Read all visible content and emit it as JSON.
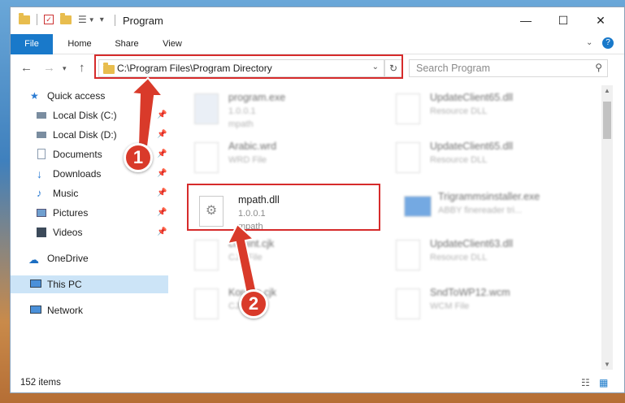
{
  "window": {
    "title": "Program"
  },
  "ribbon": {
    "tabs": [
      "File",
      "Home",
      "Share",
      "View"
    ]
  },
  "address": {
    "path": "C:\\Program Files\\Program Directory"
  },
  "search": {
    "placeholder": "Search Program"
  },
  "sidebar": {
    "items": [
      {
        "label": "Quick access",
        "icon": "star-icon",
        "pinned": false
      },
      {
        "label": "Local Disk (C:)",
        "icon": "drive-icon",
        "pinned": true
      },
      {
        "label": "Local Disk (D:)",
        "icon": "drive-icon",
        "pinned": true
      },
      {
        "label": "Documents",
        "icon": "document-icon",
        "pinned": true
      },
      {
        "label": "Downloads",
        "icon": "download-icon",
        "pinned": true
      },
      {
        "label": "Music",
        "icon": "music-icon",
        "pinned": true
      },
      {
        "label": "Pictures",
        "icon": "picture-icon",
        "pinned": true
      },
      {
        "label": "Videos",
        "icon": "video-icon",
        "pinned": true
      },
      {
        "label": "OneDrive",
        "icon": "cloud-icon",
        "pinned": false
      },
      {
        "label": "This PC",
        "icon": "computer-icon",
        "pinned": false,
        "selected": true
      },
      {
        "label": "Network",
        "icon": "network-icon",
        "pinned": false
      }
    ]
  },
  "files": [
    {
      "name": "program.exe",
      "line2": "1.0.0.1",
      "line3": "mpath",
      "blurred": true
    },
    {
      "name": "UpdateClient65.dll",
      "line2": "Resource DLL",
      "line3": "",
      "blurred": true
    },
    {
      "name": "Arabic.wrd",
      "line2": "WRD File",
      "line3": "",
      "blurred": true
    },
    {
      "name": "UpdateClient65.dll",
      "line2": "Resource DLL",
      "line3": "",
      "blurred": true
    },
    {
      "name": "mpath.dll",
      "line2": "1.0.0.1",
      "line3": "mpath",
      "blurred": false
    },
    {
      "name": "Trigrammsinstaller.exe",
      "line2": "ABBY finereader tri...",
      "line3": "",
      "blurred": true
    },
    {
      "name": "cfrmint.cjk",
      "line2": "CJK File",
      "line3": "",
      "blurred": true
    },
    {
      "name": "UpdateClient63.dll",
      "line2": "Resource DLL",
      "line3": "",
      "blurred": true
    },
    {
      "name": "Korean.cjk",
      "line2": "CJK File",
      "line3": "",
      "blurred": true
    },
    {
      "name": "SndToWP12.wcm",
      "line2": "WCM File",
      "line3": "",
      "blurred": true
    }
  ],
  "status": {
    "count": "152 items"
  },
  "annotations": {
    "badge1": "1",
    "badge2": "2"
  },
  "colors": {
    "accent": "#1979ca",
    "highlight": "#d62b2b",
    "badge": "#d93a2a"
  }
}
